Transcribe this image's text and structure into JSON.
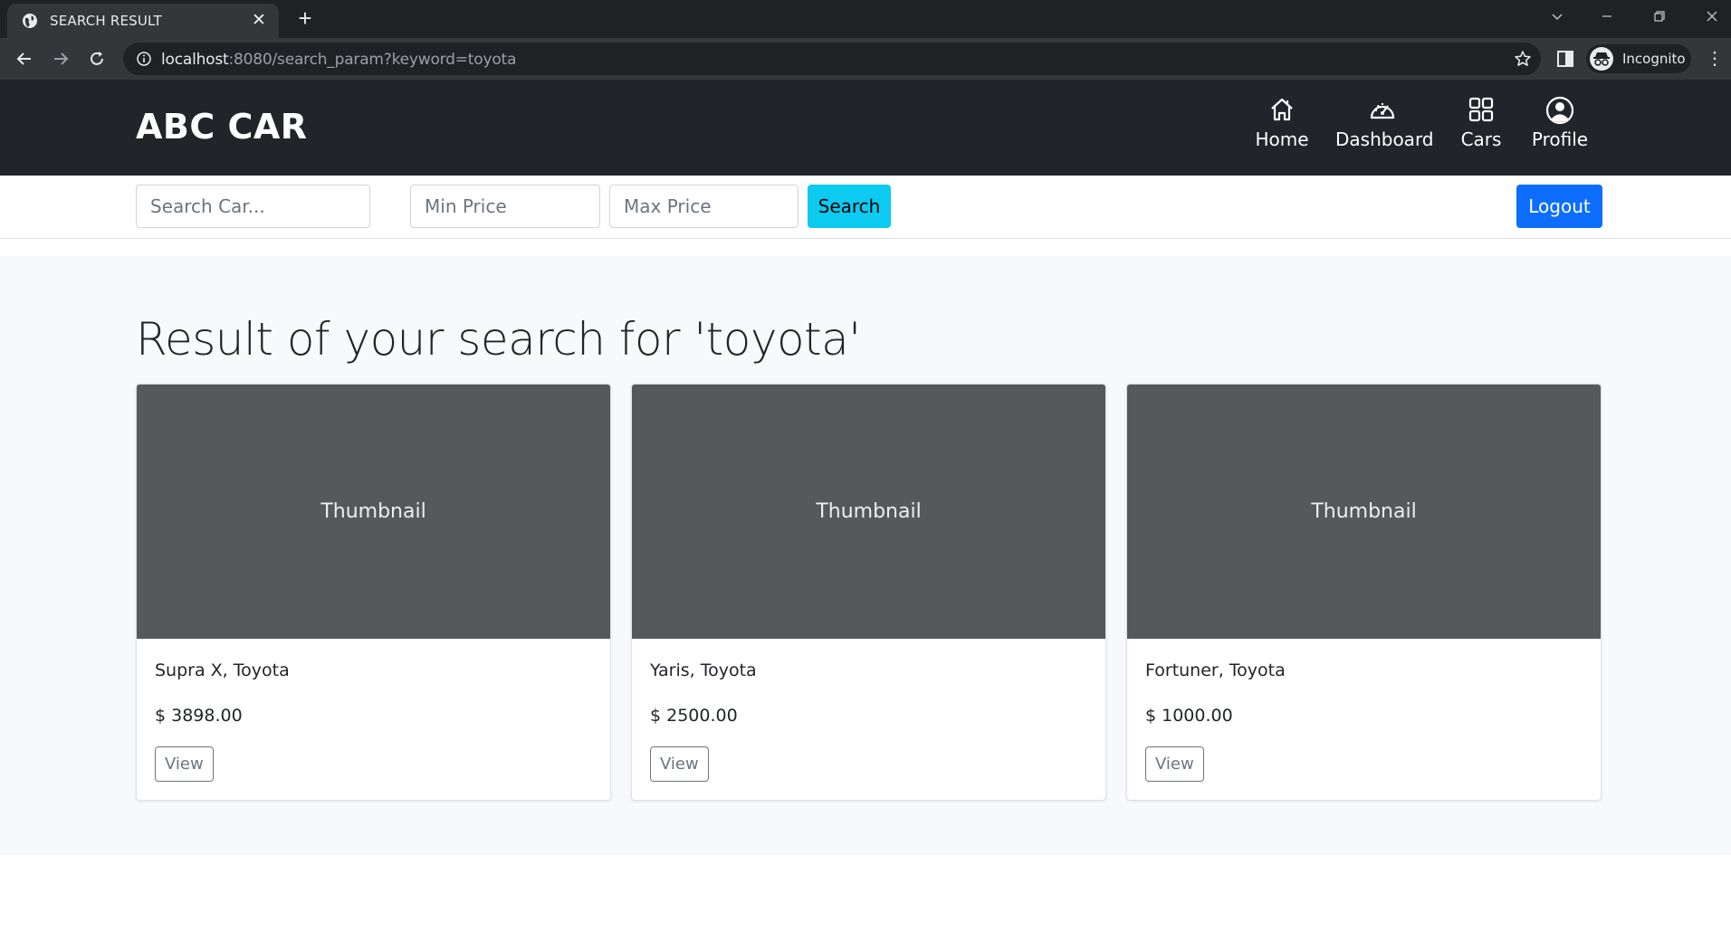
{
  "browser": {
    "tab_title": "SEARCH RESULT",
    "url_host": "localhost",
    "url_rest": ":8080/search_param?keyword=toyota",
    "profile_label": "Incognito"
  },
  "site": {
    "brand": "ABC CAR",
    "nav": [
      {
        "label": "Home",
        "icon": "home-icon"
      },
      {
        "label": "Dashboard",
        "icon": "speedometer-icon"
      },
      {
        "label": "Cars",
        "icon": "grid-icon"
      },
      {
        "label": "Profile",
        "icon": "user-circle-icon"
      }
    ]
  },
  "search": {
    "keyword_placeholder": "Search Car...",
    "min_placeholder": "Min Price",
    "max_placeholder": "Max Price",
    "search_label": "Search",
    "logout_label": "Logout"
  },
  "results": {
    "heading": "Result of your search for 'toyota'",
    "cards": [
      {
        "thumb": "Thumbnail",
        "name": "Supra X, Toyota",
        "price": "$ 3898.00",
        "view": "View"
      },
      {
        "thumb": "Thumbnail",
        "name": "Yaris, Toyota",
        "price": "$ 2500.00",
        "view": "View"
      },
      {
        "thumb": "Thumbnail",
        "name": "Fortuner, Toyota",
        "price": "$ 1000.00",
        "view": "View"
      }
    ]
  },
  "colors": {
    "navbar": "#212529",
    "search_button": "#0dcaf0",
    "logout_button": "#0d6efd",
    "thumbnail": "#55595c",
    "main_bg": "#f8f9fa"
  }
}
